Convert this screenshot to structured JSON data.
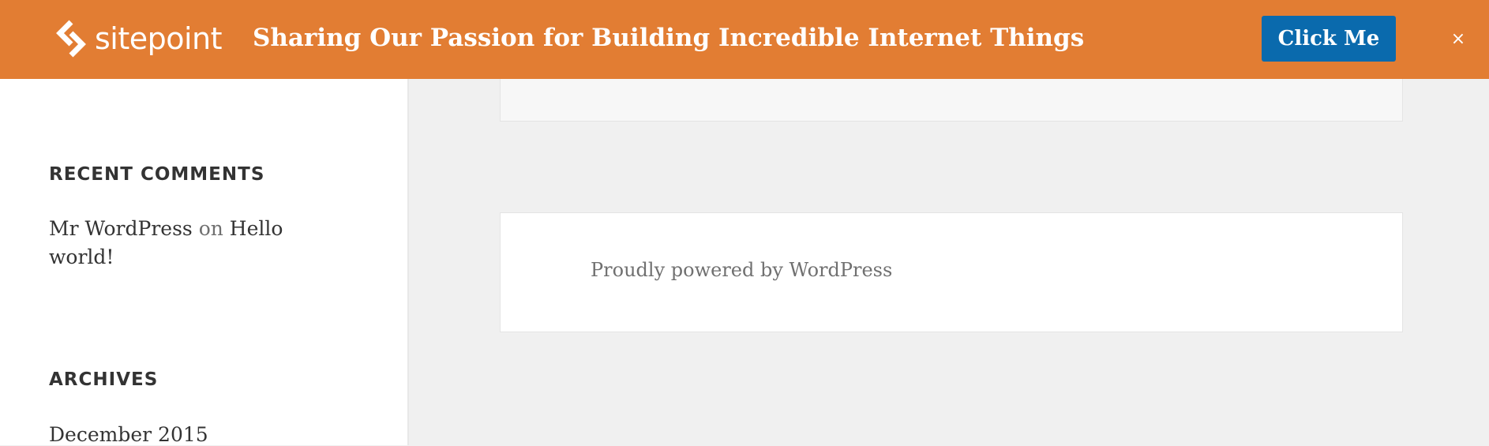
{
  "notice_bar": {
    "logo_text": "sitepoint",
    "logo_icon": "sitepoint-logo-icon",
    "tagline": "Sharing Our Passion for Building Incredible Internet Things",
    "cta_label": "Click Me",
    "close_label": "×",
    "colors": {
      "background": "#e27d33",
      "button": "#0a6aad",
      "text": "#ffffff"
    }
  },
  "sidebar": {
    "recent_comments": {
      "title": "RECENT COMMENTS",
      "items": [
        {
          "author": "Mr WordPress",
          "connector": "on",
          "post": "Hello world!"
        }
      ]
    },
    "archives": {
      "title": "ARCHIVES",
      "items": [
        "December 2015"
      ]
    }
  },
  "footer": {
    "powered_by": "Proudly powered by WordPress"
  }
}
